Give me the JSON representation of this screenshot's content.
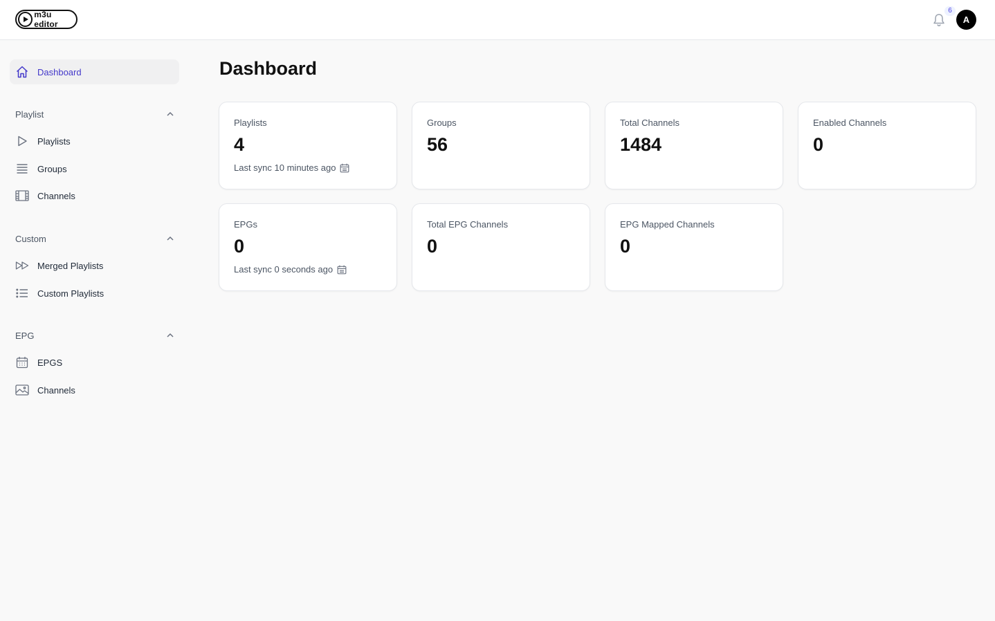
{
  "header": {
    "logo_text": "m3u editor",
    "notification_count": "6",
    "avatar_initial": "A"
  },
  "sidebar": {
    "dashboard": "Dashboard",
    "groups": [
      {
        "label": "Playlist",
        "items": [
          {
            "label": "Playlists",
            "icon": "play-icon"
          },
          {
            "label": "Groups",
            "icon": "queue-list-icon"
          },
          {
            "label": "Channels",
            "icon": "film-icon"
          }
        ]
      },
      {
        "label": "Custom",
        "items": [
          {
            "label": "Merged Playlists",
            "icon": "forward-icon"
          },
          {
            "label": "Custom Playlists",
            "icon": "list-bullet-icon"
          }
        ]
      },
      {
        "label": "EPG",
        "items": [
          {
            "label": "EPGS",
            "icon": "calendar-icon"
          },
          {
            "label": "Channels",
            "icon": "photo-icon"
          }
        ]
      }
    ]
  },
  "main": {
    "title": "Dashboard",
    "stats": [
      {
        "label": "Playlists",
        "value": "4",
        "desc": "Last sync 10 minutes ago"
      },
      {
        "label": "Groups",
        "value": "56",
        "desc": ""
      },
      {
        "label": "Total Channels",
        "value": "1484",
        "desc": ""
      },
      {
        "label": "Enabled Channels",
        "value": "0",
        "desc": ""
      },
      {
        "label": "EPGs",
        "value": "0",
        "desc": "Last sync 0 seconds ago"
      },
      {
        "label": "Total EPG Channels",
        "value": "0",
        "desc": ""
      },
      {
        "label": "EPG Mapped Channels",
        "value": "0",
        "desc": ""
      }
    ]
  },
  "colors": {
    "accent": "#4338ca",
    "background": "#f9f9f9",
    "card": "#ffffff"
  }
}
